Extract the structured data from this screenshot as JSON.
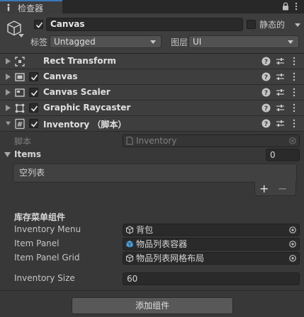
{
  "tab": {
    "label": "检查器"
  },
  "header": {
    "object_name": "Canvas",
    "static_label": "静态的",
    "tag_label": "标签",
    "tag_value": "Untagged",
    "layer_label": "图层",
    "layer_value": "UI"
  },
  "components": [
    {
      "name": "Rect Transform",
      "has_checkbox": false,
      "icon": "rect-transform-icon"
    },
    {
      "name": "Canvas",
      "has_checkbox": true,
      "icon": "canvas-icon"
    },
    {
      "name": "Canvas Scaler",
      "has_checkbox": true,
      "icon": "canvas-scaler-icon"
    },
    {
      "name": "Graphic Raycaster",
      "has_checkbox": true,
      "icon": "raycaster-icon"
    },
    {
      "name": "Inventory （脚本）",
      "has_checkbox": true,
      "icon": "script-icon",
      "expanded": true
    }
  ],
  "inventory": {
    "script_label": "脚本",
    "script_value": "Inventory",
    "items_label": "Items",
    "items_count": "0",
    "list_empty": "空列表",
    "add_symbol": "+",
    "remove_symbol": "−",
    "section_title": "库存菜单组件",
    "fields": [
      {
        "label": "Inventory Menu",
        "value": "背包",
        "icon": "gameobject-icon"
      },
      {
        "label": "Item Panel",
        "value": "物品列表容器",
        "icon": "prefab-icon"
      },
      {
        "label": "Item Panel Grid",
        "value": "物品列表网格布局",
        "icon": "gameobject-icon"
      }
    ],
    "size_label": "Inventory Size",
    "size_value": "60"
  },
  "add_component_label": "添加组件",
  "colors": {
    "accent": "#3a79bb",
    "background": "#383838",
    "header": "#3e3e3e"
  }
}
